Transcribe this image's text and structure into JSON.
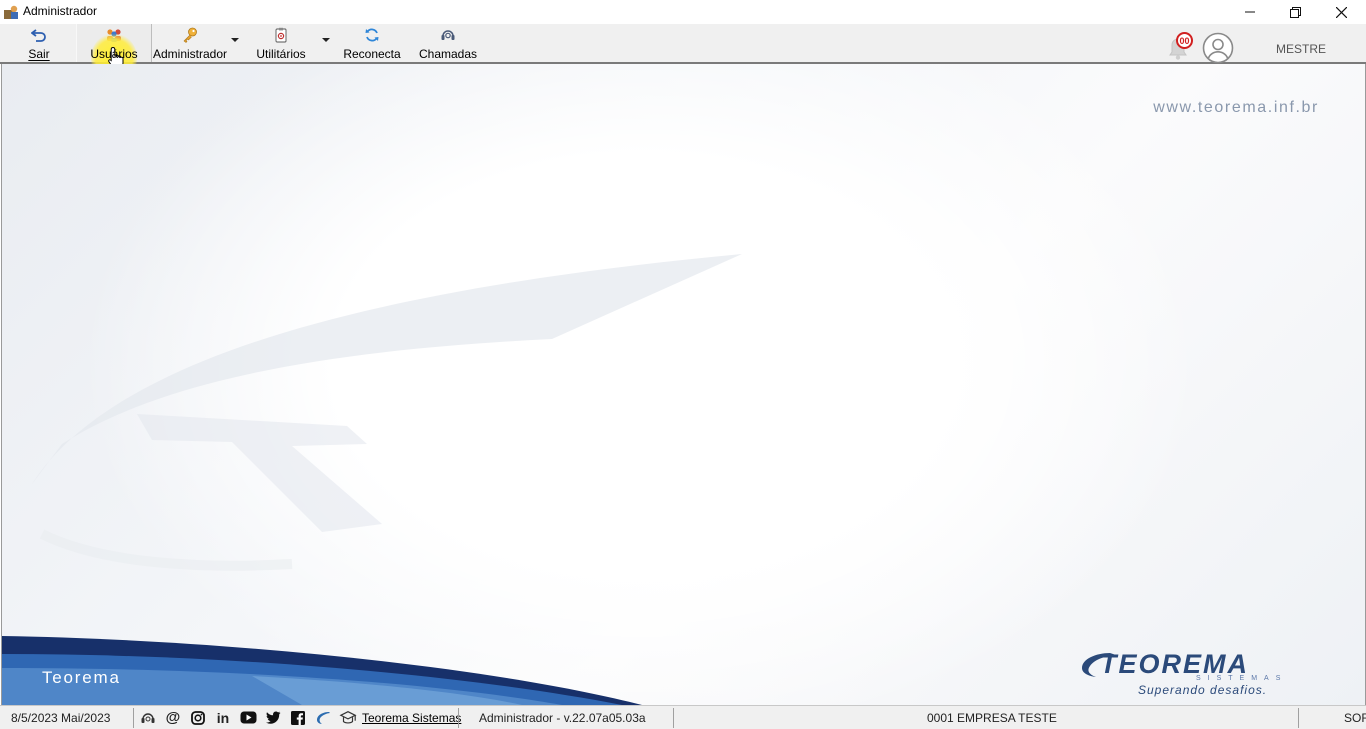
{
  "window": {
    "title": "Administrador",
    "controls": [
      "minimize-icon",
      "restore-icon",
      "close-icon"
    ]
  },
  "toolbar": {
    "buttons": [
      {
        "label": "Sair",
        "icon": "exit-arrow-icon"
      },
      {
        "label": "Usuários",
        "icon": "users-icon",
        "state": "pressed"
      },
      {
        "label": "Administrador",
        "icon": "key-icon",
        "has_dropdown": true
      },
      {
        "label": "Utilitários",
        "icon": "utilities-icon",
        "has_dropdown": true
      },
      {
        "label": "Reconecta",
        "icon": "reconnect-icon"
      },
      {
        "label": "Chamadas",
        "icon": "support-call-icon"
      }
    ],
    "notifications_count": "00",
    "user_name": "MESTRE"
  },
  "main": {
    "website": "www.teorema.inf.br",
    "brand_text": "Teorema",
    "logo": {
      "name": "TEOREMA",
      "sub": "SISTEMAS",
      "slogan": "Superando desafios."
    },
    "colors": {
      "brand_blue": "#2b4a7a",
      "wave_blue": "#1f3f7d",
      "url_gray": "#8a98ad"
    }
  },
  "statusbar": {
    "date": "8/5/2023 Mai/2023",
    "social_icons": [
      "support-icon",
      "email-at-icon",
      "instagram-icon",
      "linkedin-icon",
      "youtube-icon",
      "twitter-icon",
      "facebook-icon",
      "teorema-swoosh-icon"
    ],
    "company_link": "Teorema Sistemas",
    "version": "Administrador - v.22.07a05.03a",
    "company": "0001 EMPRESA TESTE",
    "trailing": "SOF"
  }
}
